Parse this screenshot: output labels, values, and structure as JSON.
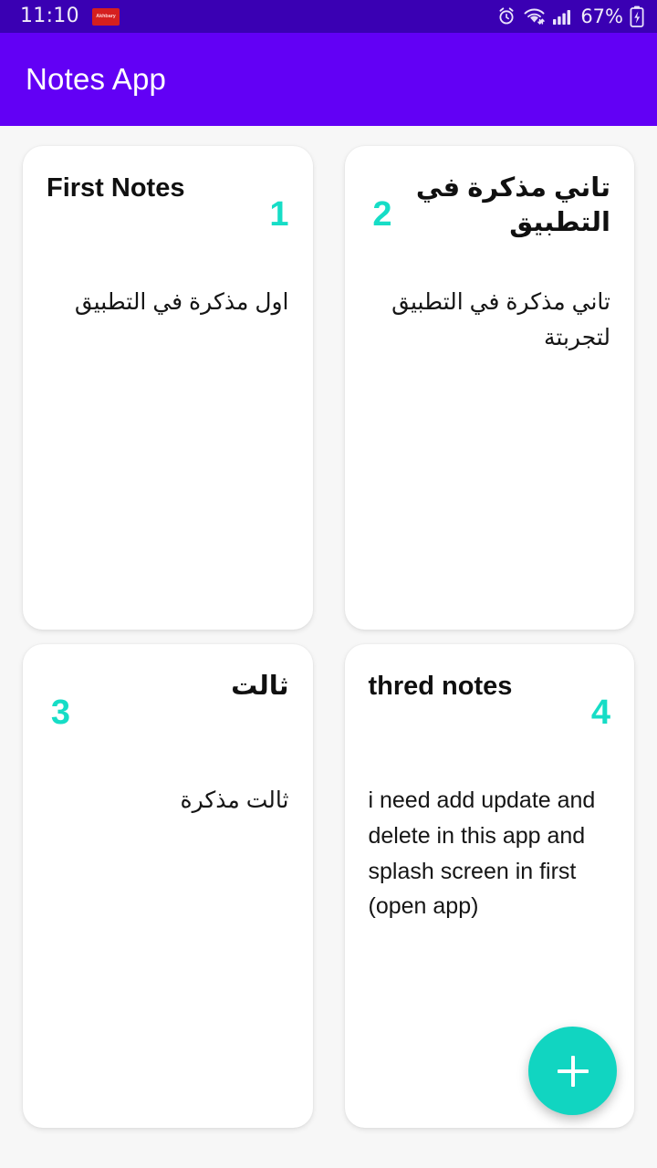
{
  "status_bar": {
    "clock": "11:10",
    "notification_app_label": "Akhbary",
    "battery_percent": "67%",
    "icons": [
      "alarm-icon",
      "wifi-icon",
      "cellular-signal-icon",
      "battery-charging-icon"
    ],
    "background_color": "#3a00b3"
  },
  "app_bar": {
    "title": "Notes App",
    "background_color": "#6200f5",
    "text_color": "#ffffff"
  },
  "theme": {
    "accent_color": "#11d5c1",
    "page_background": "#f7f7f7",
    "card_background": "#ffffff",
    "note_number_color": "#16ddc6"
  },
  "fab": {
    "label": "+",
    "icon": "plus-icon",
    "color": "#11d5c1"
  },
  "notes": [
    {
      "number": "1",
      "title": "First Notes",
      "body": "اول مذكرة في التطبيق",
      "dir": "ltr",
      "body_dir": "rtl"
    },
    {
      "number": "2",
      "title": "تاني مذكرة في التطبيق",
      "body": "تاني مذكرة في التطبيق لتجربتة",
      "dir": "rtl",
      "body_dir": "rtl"
    },
    {
      "number": "3",
      "title": "ثالت",
      "body": "ثالت مذكرة",
      "dir": "rtl",
      "body_dir": "rtl"
    },
    {
      "number": "4",
      "title": "thred notes",
      "body": "i need add update and delete in this app and splash screen in first (open app)",
      "dir": "ltr",
      "body_dir": "ltr"
    }
  ]
}
